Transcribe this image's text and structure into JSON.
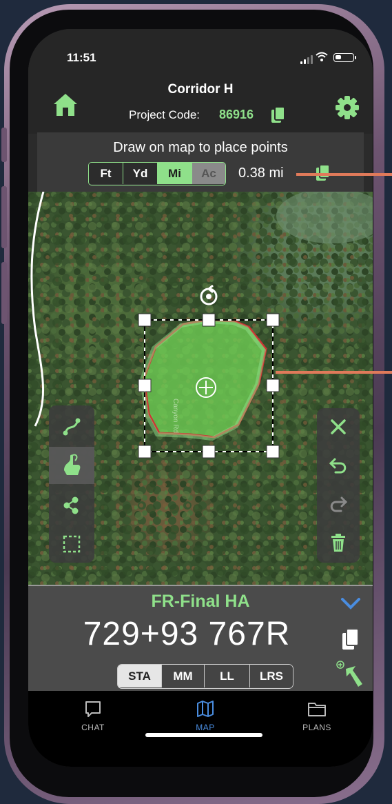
{
  "status_bar": {
    "time": "11:51",
    "battery_level": 0.35
  },
  "header": {
    "title": "Corridor H",
    "project_code_label": "Project Code:",
    "project_code_value": "86916",
    "icons": [
      "home-icon",
      "gear-icon",
      "copy-icon"
    ],
    "accent_color": "#8fe08a"
  },
  "draw_banner": {
    "instruction": "Draw on map to place points",
    "units": [
      {
        "label": "Ft",
        "state": "normal"
      },
      {
        "label": "Yd",
        "state": "normal"
      },
      {
        "label": "Mi",
        "state": "selected"
      },
      {
        "label": "Ac",
        "state": "disabled"
      }
    ],
    "measurement": "0.38 mi"
  },
  "map": {
    "road_label": "Canyon Rd",
    "shape": "polygon selection with bounding box handles",
    "icons": [
      "rotate-handle-icon",
      "move-center-icon"
    ]
  },
  "left_tools": {
    "items": [
      {
        "name": "line-draw-icon",
        "active": false
      },
      {
        "name": "freehand-draw-icon",
        "active": true
      },
      {
        "name": "point-draw-icon",
        "active": false
      },
      {
        "name": "rectangle-select-icon",
        "active": false
      }
    ]
  },
  "right_tools": {
    "items": [
      {
        "name": "close-icon",
        "enabled": true
      },
      {
        "name": "undo-icon",
        "enabled": true
      },
      {
        "name": "redo-icon",
        "enabled": false
      },
      {
        "name": "trash-icon",
        "enabled": true
      }
    ]
  },
  "station_panel": {
    "label": "FR-Final HA",
    "value": "729+93 767R",
    "modes": [
      {
        "label": "STA",
        "active": true
      },
      {
        "label": "MM",
        "active": false
      },
      {
        "label": "LL",
        "active": false
      },
      {
        "label": "LRS",
        "active": false
      }
    ]
  },
  "tab_bar": {
    "tabs": [
      {
        "label": "CHAT",
        "icon": "chat-icon",
        "active": false
      },
      {
        "label": "MAP",
        "icon": "map-icon",
        "active": true
      },
      {
        "label": "PLANS",
        "icon": "folder-icon",
        "active": false
      }
    ],
    "active_color": "#4a8de0"
  }
}
